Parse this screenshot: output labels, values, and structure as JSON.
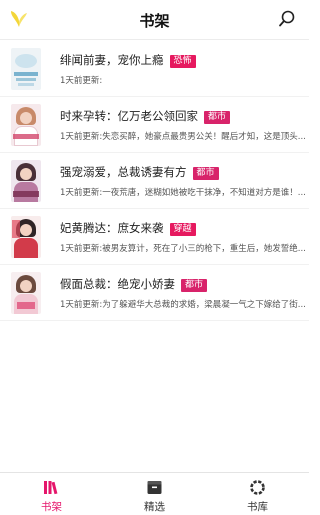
{
  "app": {
    "title": "书架"
  },
  "colors": {
    "accent": "#e5166b",
    "tag": "#e6195f"
  },
  "books": [
    {
      "title": "绯闻前妻，宠你上瘾",
      "tag": "恐怖",
      "update": "1天前更新:"
    },
    {
      "title": "时来孕转：亿万老公领回家",
      "tag": "都市",
      "update": "1天前更新:失恋买醉，她豪点最贵男公关！醒后才知，这是顶头..."
    },
    {
      "title": "强宠溺爱，总裁诱妻有方",
      "tag": "都市",
      "update": "1天前更新:一夜荒唐，迷糊如她被吃干抹净，不知道对方是谁！..."
    },
    {
      "title": "妃黄腾达：庶女来袭",
      "tag": "穿越",
      "update": "1天前更新:被男友算计，死在了小三的枪下，重生后，她发誓绝..."
    },
    {
      "title": "假面总裁：绝宠小娇妻",
      "tag": "都市",
      "update": "1天前更新:为了躲避华大总裁的求婚，梁晨凝一气之下嫁给了街..."
    }
  ],
  "tabs": [
    {
      "label": "书架",
      "icon": "bookshelf-icon",
      "active": true
    },
    {
      "label": "精选",
      "icon": "featured-box-icon",
      "active": false
    },
    {
      "label": "书库",
      "icon": "library-ring-icon",
      "active": false
    }
  ]
}
